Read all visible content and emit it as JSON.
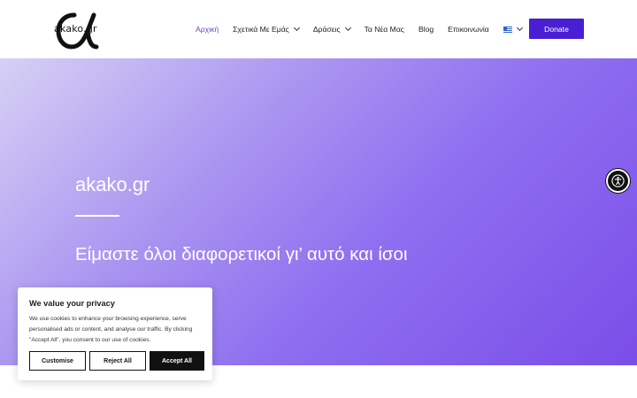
{
  "header": {
    "logo_text": "akako.gr",
    "nav": [
      {
        "label": "Αρχική",
        "active": true,
        "dropdown": false
      },
      {
        "label": "Σχετικά Με Εμάς",
        "active": false,
        "dropdown": true
      },
      {
        "label": "Δράσεις",
        "active": false,
        "dropdown": true
      },
      {
        "label": "Τα Νέα Μας",
        "active": false,
        "dropdown": false
      },
      {
        "label": "Blog",
        "active": false,
        "dropdown": false
      },
      {
        "label": "Επικοινωνία",
        "active": false,
        "dropdown": false
      }
    ],
    "language_icon": "greek-flag-icon",
    "donate_label": "Donate"
  },
  "hero": {
    "title": "akako.gr",
    "subtitle": "Είμαστε όλοι διαφορετικοί γι’ αυτό και ίσοι"
  },
  "cookie": {
    "title": "We value your privacy",
    "text": "We use cookies to enhance your browsing experience, serve personalised ads or content, and analyse our traffic. By clicking \"Accept All\", you consent to our use of cookies.",
    "customise_label": "Customise",
    "reject_label": "Reject All",
    "accept_label": "Accept All"
  },
  "colors": {
    "accent": "#4a1fd4",
    "active_nav": "#6a3dd3"
  }
}
